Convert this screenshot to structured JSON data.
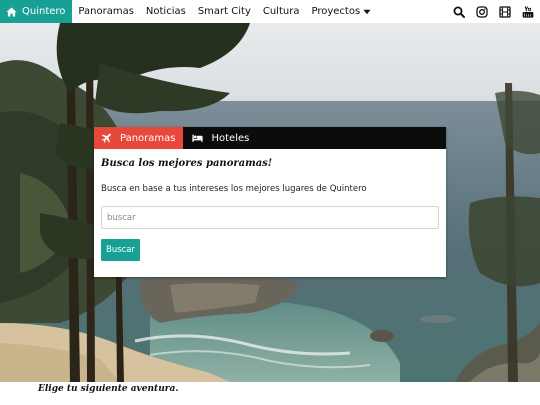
{
  "nav": {
    "items": [
      {
        "label": "Quintero",
        "icon": "home-icon",
        "active": true
      },
      {
        "label": "Panoramas"
      },
      {
        "label": "Noticias"
      },
      {
        "label": "Smart City"
      },
      {
        "label": "Cultura"
      },
      {
        "label": "Proyectos",
        "icon": "caret-down-icon"
      }
    ],
    "right_icons": [
      "search-icon",
      "instagram-icon",
      "film-icon",
      "youtube-icon"
    ]
  },
  "hero": {
    "image": "coastal cove with pine trees and ocean"
  },
  "panel": {
    "tabs": [
      {
        "label": "Panoramas",
        "icon": "plane-icon",
        "active": true
      },
      {
        "label": "Hoteles",
        "icon": "bed-icon"
      }
    ],
    "heading": "Busca los mejores panoramas!",
    "text": "Busca en base a tus intereses los mejores lugares de Quintero",
    "search": {
      "value": "",
      "placeholder": "buscar"
    },
    "button_label": "Buscar"
  },
  "tagline": "Elige tu siguiente aventura.",
  "colors": {
    "teal": "#17a093",
    "red_tab": "#e8483b",
    "tab_bar": "#0c0c0c"
  }
}
